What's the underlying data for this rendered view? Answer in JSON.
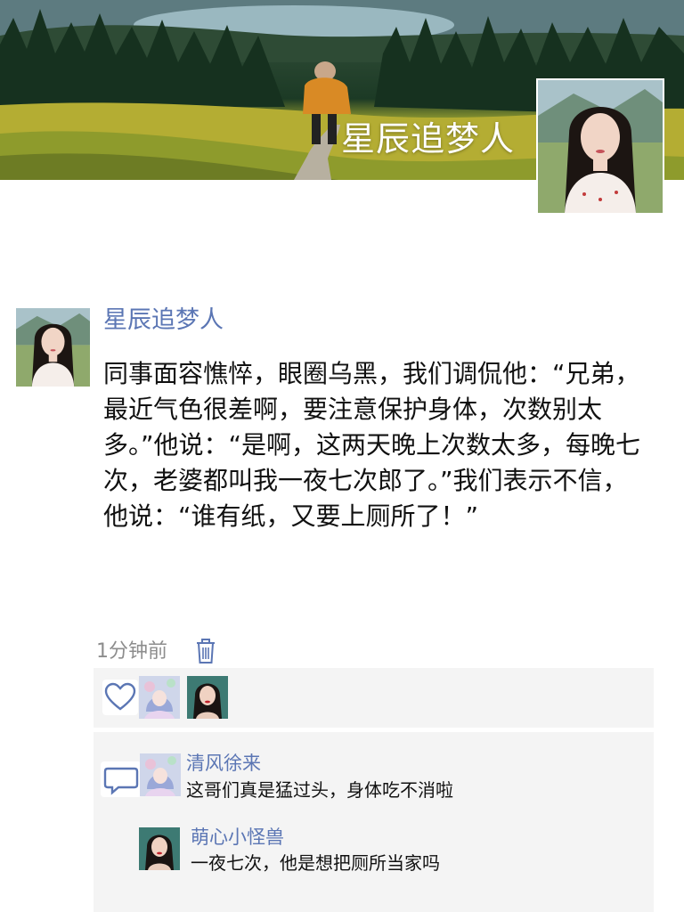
{
  "profile": {
    "cover_name": "星辰追梦人",
    "avatar_icon": "woman-portrait-avatar"
  },
  "post": {
    "author": "星辰追梦人",
    "text": "同事面容憔悴，眼圈乌黑，我们调侃他：“兄弟，最近气色很差啊，要注意保护身体，次数别太多。”他说：“是啊，这两天晚上次数太多，每晚七次，老婆都叫我一夜七次郎了。”我们表示不信，他说：“谁有纸，又要上厕所了！”",
    "time": "1分钟前",
    "delete_icon": "trash-icon"
  },
  "likes": {
    "icon": "heart-icon",
    "avatars": [
      "anime-girl-avatar",
      "woman-red-lips-avatar"
    ]
  },
  "comments": {
    "icon": "comment-bubble-icon",
    "items": [
      {
        "name": "清风徐来",
        "text": "这哥们真是猛过头，身体吃不消啦",
        "avatar": "anime-girl-avatar"
      },
      {
        "name": "萌心小怪兽",
        "text": "一夜七次，他是想把厕所当家吗",
        "avatar": "woman-red-lips-avatar"
      }
    ]
  },
  "colors": {
    "name_blue": "#5b76b4",
    "panel_gray": "#f4f4f4",
    "time_gray": "#8d8d8d",
    "text_black": "#111111"
  }
}
